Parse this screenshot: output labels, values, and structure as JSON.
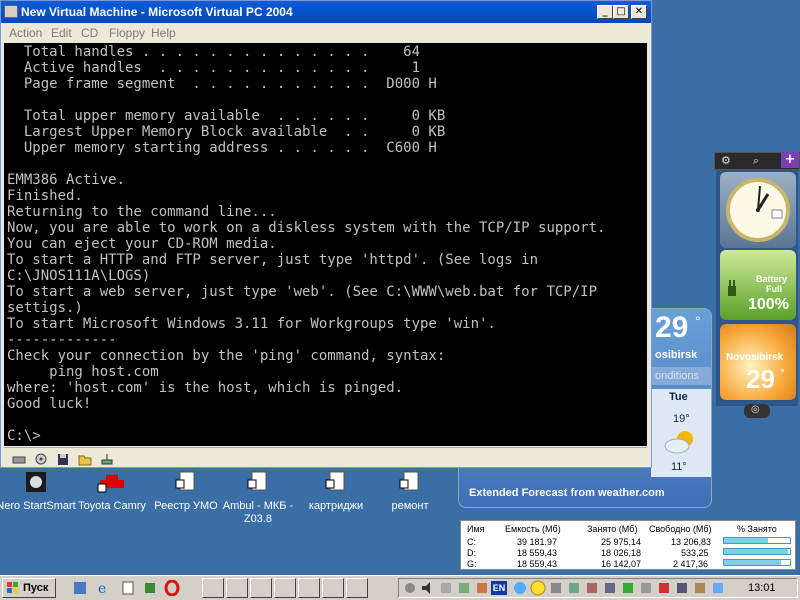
{
  "window": {
    "title": "New Virtual Machine - Microsoft Virtual PC 2004",
    "menu": [
      "Action",
      "Edit",
      "CD",
      "Floppy",
      "Help"
    ]
  },
  "console_lines": [
    "  Total handles . . . . . . . . . . . . . .    64",
    "  Active handles  . . . . . . . . . . . . .     1",
    "  Page frame segment  . . . . . . . . . . .  D000 H",
    "",
    "  Total upper memory available  . . . . . .     0 KB",
    "  Largest Upper Memory Block available  . .     0 KB",
    "  Upper memory starting address . . . . . .  C600 H",
    "",
    "EMM386 Active.",
    "Finished.",
    "Returning to the command line...",
    "Now, you are able to work on a diskless system with the TCP/IP support.",
    "You can eject your CD-ROM media.",
    "To start a HTTP and FTP server, just type 'httpd'. (See logs in",
    "C:\\JNOS111A\\LOGS)",
    "To start a web server, just type 'web'. (See C:\\WWW\\web.bat for TCP/IP",
    "settigs.)",
    "To start Microsoft Windows 3.11 for Workgroups type 'win'.",
    "-------------",
    "Check your connection by the 'ping' command, syntax:",
    "     ping host.com",
    "where: 'host.com' is the host, which is pinged.",
    "Good luck!",
    "",
    "C:\\>"
  ],
  "desktop_icons": [
    {
      "label": "Nero StartSmart"
    },
    {
      "label": "Toyota Camry"
    },
    {
      "label": "Реестр УМО"
    },
    {
      "label": "Ambul - МКБ - Z03.8"
    },
    {
      "label": "картриджи"
    },
    {
      "label": "ремонт"
    }
  ],
  "gadgets": {
    "battery": {
      "label": "Battery",
      "status": "Full",
      "percent": "100%"
    },
    "weather_small": {
      "temp": "29",
      "deg": "°",
      "city": "Novosibirsk"
    },
    "weather_big": {
      "temp": "29",
      "deg": "°",
      "city": "osibirsk",
      "conditions": "onditions",
      "forecast_day": "Tue",
      "forecast_high": "19°",
      "forecast_low": "11°",
      "footer": "Extended Forecast from weather.com"
    }
  },
  "disk_usage": {
    "headers": [
      "Имя",
      "Емкость (Мб)",
      "Занято (Мб)",
      "Свободно (Мб)",
      "% Занято"
    ],
    "rows": [
      {
        "name": "C:",
        "capacity": "39 181,97",
        "used": "25 975,14",
        "free": "13 206,83",
        "percent_used": 66
      },
      {
        "name": "D:",
        "capacity": "18 559,43",
        "used": "18 026,18",
        "free": "533,25",
        "percent_used": 97
      },
      {
        "name": "G:",
        "capacity": "18 559,43",
        "used": "16 142,07",
        "free": "2 417,36",
        "percent_used": 87
      }
    ]
  },
  "taskbar": {
    "start_label": "Пуск",
    "lang": "EN",
    "clock": "13:01"
  }
}
